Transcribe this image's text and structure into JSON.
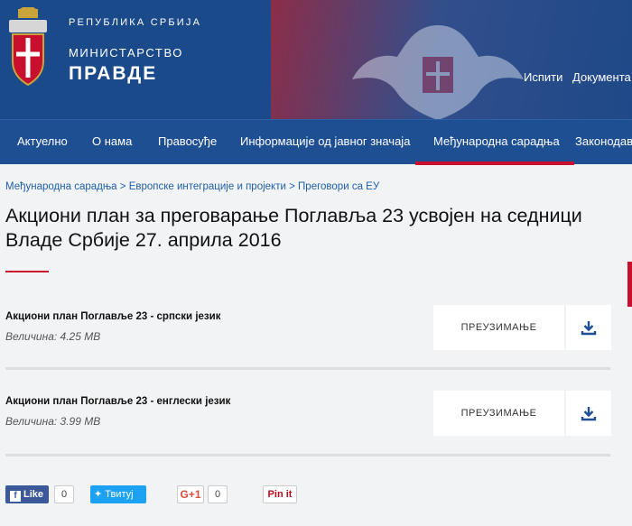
{
  "header": {
    "line1": "РЕПУБЛИКА СРБИЈА",
    "line2": "МИНИСТАРСТВО",
    "line3": "ПРАВДЕ",
    "links": [
      "Испити",
      "Документа"
    ]
  },
  "nav": {
    "items": [
      {
        "label": "Актуелно"
      },
      {
        "label": "О нама"
      },
      {
        "label": "Правосуђе"
      },
      {
        "label": "Информације од јавног значаја"
      },
      {
        "label": "Међународна сарадња",
        "active": true
      },
      {
        "label": "Законодавств"
      }
    ]
  },
  "breadcrumb": [
    "Међународна сарадња",
    "Европске интеграције и пројекти",
    "Преговори са ЕУ"
  ],
  "breadcrumb_sep": ">",
  "page": {
    "title": "Акциони план за преговарање Поглавља 23 усвојен на седници Владе Србије 27. априла 2016"
  },
  "files": [
    {
      "name": "Акциони план Поглавље 23 - српски језик",
      "size": "Величина: 4.25 MB",
      "button": "ПРЕУЗИМАЊЕ"
    },
    {
      "name": "Акциони план Поглавље 23 - енглески језик",
      "size": "Величина: 3.99 MB",
      "button": "ПРЕУЗИМАЊЕ"
    }
  ],
  "social": {
    "like": "Like",
    "like_count": "0",
    "tweet": "Твитуј",
    "gplus": "G+1",
    "gplus_count": "0",
    "pin": "Pin it"
  },
  "colors": {
    "nav_bg": "#1e4f93",
    "accent": "#c8102e",
    "link": "#1f5fa8"
  }
}
